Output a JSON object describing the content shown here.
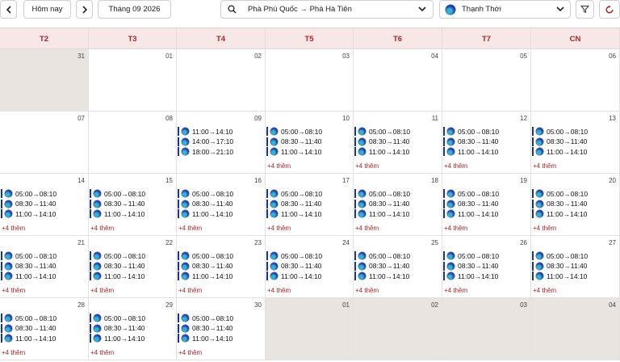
{
  "toolbar": {
    "today_label": "Hôm nay",
    "month_label": "Tháng 09 2026",
    "route_value": "Phà Phú Quốc → Phà Hà Tiên",
    "ship_value": "Thạnh Thới"
  },
  "icons": {
    "prev": "chevron-left-icon",
    "next": "chevron-right-icon",
    "search": "search-icon",
    "dropdown": "chevron-down-icon",
    "filter": "filter-icon",
    "refresh": "refresh-icon",
    "ship_logo": "ship-logo-icon"
  },
  "colors": {
    "accent": "#b22222",
    "header_bg": "#f7e7e7",
    "event_border": "#14349a",
    "outside_month_bg": "#e9e4e0"
  },
  "weekdays": [
    "T2",
    "T3",
    "T4",
    "T5",
    "T6",
    "T7",
    "CN"
  ],
  "weeks": [
    [
      {
        "day": "31",
        "outside": true,
        "events": []
      },
      {
        "day": "01",
        "outside": false,
        "events": []
      },
      {
        "day": "02",
        "outside": false,
        "events": []
      },
      {
        "day": "03",
        "outside": false,
        "events": []
      },
      {
        "day": "04",
        "outside": false,
        "events": []
      },
      {
        "day": "05",
        "outside": false,
        "events": []
      },
      {
        "day": "06",
        "outside": false,
        "events": []
      }
    ],
    [
      {
        "day": "07",
        "outside": false,
        "events": []
      },
      {
        "day": "08",
        "outside": false,
        "events": []
      },
      {
        "day": "09",
        "outside": false,
        "events": [
          "11:00→14:10",
          "14:00→17:10",
          "18:00→21:10"
        ]
      },
      {
        "day": "10",
        "outside": false,
        "events": [
          "05:00→08:10",
          "08:30→11:40",
          "11:00→14:10"
        ],
        "more": "+4 thêm"
      },
      {
        "day": "11",
        "outside": false,
        "events": [
          "05:00→08:10",
          "08:30→11:40",
          "11:00→14:10"
        ],
        "more": "+4 thêm"
      },
      {
        "day": "12",
        "outside": false,
        "events": [
          "05:00→08:10",
          "08:30→11:40",
          "11:00→14:10"
        ],
        "more": "+4 thêm"
      },
      {
        "day": "13",
        "outside": false,
        "events": [
          "05:00→08:10",
          "08:30→11:40",
          "11:00→14:10"
        ],
        "more": "+4 thêm"
      }
    ],
    [
      {
        "day": "14",
        "outside": false,
        "events": [
          "05:00→08:10",
          "08:30→11:40",
          "11:00→14:10"
        ],
        "more": "+4 thêm"
      },
      {
        "day": "15",
        "outside": false,
        "events": [
          "05:00→08:10",
          "08:30→11:40",
          "11:00→14:10"
        ],
        "more": "+4 thêm"
      },
      {
        "day": "16",
        "outside": false,
        "events": [
          "05:00→08:10",
          "08:30→11:40",
          "11:00→14:10"
        ],
        "more": "+4 thêm"
      },
      {
        "day": "17",
        "outside": false,
        "events": [
          "05:00→08:10",
          "08:30→11:40",
          "11:00→14:10"
        ],
        "more": "+4 thêm"
      },
      {
        "day": "18",
        "outside": false,
        "events": [
          "05:00→08:10",
          "08:30→11:40",
          "11:00→14:10"
        ],
        "more": "+4 thêm"
      },
      {
        "day": "19",
        "outside": false,
        "events": [
          "05:00→08:10",
          "08:30→11:40",
          "11:00→14:10"
        ],
        "more": "+4 thêm"
      },
      {
        "day": "20",
        "outside": false,
        "events": [
          "05:00→08:10",
          "08:30→11:40",
          "11:00→14:10"
        ],
        "more": "+4 thêm"
      }
    ],
    [
      {
        "day": "21",
        "outside": false,
        "events": [
          "05:00→08:10",
          "08:30→11:40",
          "11:00→14:10"
        ],
        "more": "+4 thêm"
      },
      {
        "day": "22",
        "outside": false,
        "events": [
          "05:00→08:10",
          "08:30→11:40",
          "11:00→14:10"
        ],
        "more": "+4 thêm"
      },
      {
        "day": "23",
        "outside": false,
        "events": [
          "05:00→08:10",
          "08:30→11:40",
          "11:00→14:10"
        ],
        "more": "+4 thêm"
      },
      {
        "day": "24",
        "outside": false,
        "events": [
          "05:00→08:10",
          "08:30→11:40",
          "11:00→14:10"
        ],
        "more": "+4 thêm"
      },
      {
        "day": "25",
        "outside": false,
        "events": [
          "05:00→08:10",
          "08:30→11:40",
          "11:00→14:10"
        ],
        "more": "+4 thêm"
      },
      {
        "day": "26",
        "outside": false,
        "events": [
          "05:00→08:10",
          "08:30→11:40",
          "11:00→14:10"
        ],
        "more": "+4 thêm"
      },
      {
        "day": "27",
        "outside": false,
        "events": [
          "05:00→08:10",
          "08:30→11:40",
          "11:00→14:10"
        ],
        "more": "+4 thêm"
      }
    ],
    [
      {
        "day": "28",
        "outside": false,
        "events": [
          "05:00→08:10",
          "08:30→11:40",
          "11:00→14:10"
        ],
        "more": "+4 thêm"
      },
      {
        "day": "29",
        "outside": false,
        "events": [
          "05:00→08:10",
          "08:30→11:40",
          "11:00→14:10"
        ],
        "more": "+4 thêm"
      },
      {
        "day": "30",
        "outside": false,
        "events": [
          "05:00→08:10",
          "08:30→11:40",
          "11:00→14:10"
        ],
        "more": "+4 thêm"
      },
      {
        "day": "01",
        "outside": true,
        "events": []
      },
      {
        "day": "02",
        "outside": true,
        "events": []
      },
      {
        "day": "03",
        "outside": true,
        "events": []
      },
      {
        "day": "04",
        "outside": true,
        "events": []
      }
    ]
  ]
}
